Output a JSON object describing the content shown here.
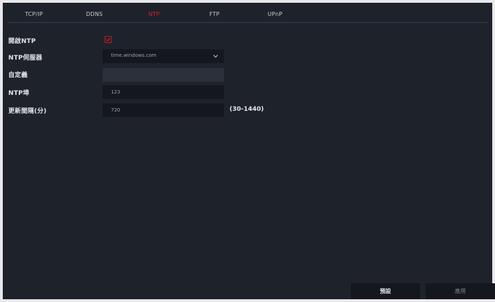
{
  "tabs": [
    {
      "label": "TCP/IP",
      "active": false
    },
    {
      "label": "DDNS",
      "active": false
    },
    {
      "label": "NTP",
      "active": true
    },
    {
      "label": "FTP",
      "active": false
    },
    {
      "label": "UPnP",
      "active": false
    }
  ],
  "form": {
    "enable_ntp": {
      "label": "開啟NTP",
      "checked": true
    },
    "ntp_server": {
      "label": "NTP伺服器",
      "value": "time.windows.com"
    },
    "custom": {
      "label": "自定義",
      "value": ""
    },
    "ntp_port": {
      "label": "NTP埠",
      "value": "123"
    },
    "update_interval": {
      "label": "更新間隔(分)",
      "value": "720",
      "range_hint": "(30-1440)"
    }
  },
  "buttons": {
    "default_label": "預設",
    "apply_label": "應用"
  },
  "colors": {
    "background": "#1e222b",
    "accent": "#e01b22",
    "field_dark": "#14171d",
    "field_disabled": "#2b303a"
  },
  "icons": {
    "checkbox_check": "check-icon",
    "dropdown": "chevron-down-icon"
  }
}
